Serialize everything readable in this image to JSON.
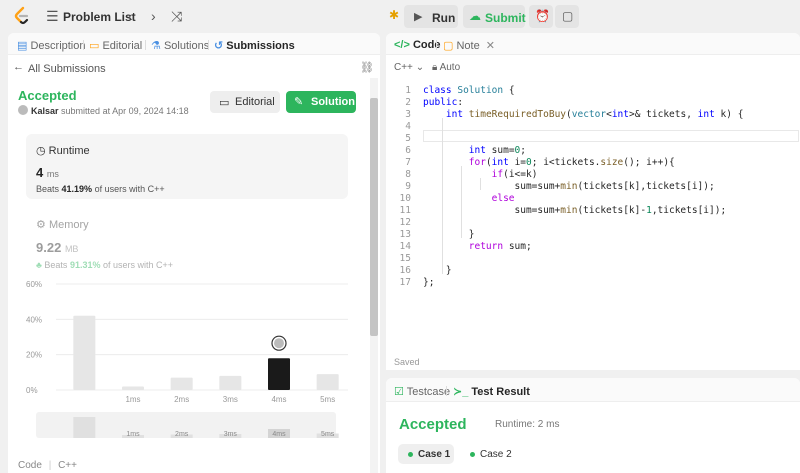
{
  "topbar": {
    "problem_list": "Problem List",
    "run_label": "Run",
    "submit_label": "Submit"
  },
  "left_tabs": [
    {
      "label": "Description"
    },
    {
      "label": "Editorial"
    },
    {
      "label": "Solutions"
    },
    {
      "label": "Submissions"
    }
  ],
  "back_link": "All Submissions",
  "submission": {
    "status": "Accepted",
    "user": "Kalsar",
    "meta": "submitted at Apr 09, 2024 14:18",
    "editorial_btn": "Editorial",
    "solution_btn": "Solution"
  },
  "runtime": {
    "title": "Runtime",
    "value": "4",
    "unit": "ms",
    "beats_prefix": "Beats",
    "beats_pct": "41.19%",
    "beats_suffix": "of users with C++"
  },
  "memory": {
    "title": "Memory",
    "value": "9.22",
    "unit": "MB",
    "beats_prefix": "Beats",
    "beats_pct": "91.31%",
    "beats_suffix": "of users with C++"
  },
  "chart_data": {
    "type": "bar",
    "categories": [
      "",
      "1ms",
      "2ms",
      "3ms",
      "4ms",
      "5ms"
    ],
    "values": [
      42,
      2,
      7,
      8,
      18,
      9
    ],
    "highlight_index": 4,
    "yticks": [
      "60%",
      "40%",
      "20%",
      "0%"
    ],
    "ylim": [
      0,
      60
    ],
    "grid": true,
    "overview_labels": [
      "1ms",
      "2ms",
      "3ms",
      "4ms",
      "5ms"
    ]
  },
  "left_footer": {
    "code": "Code",
    "lang": "C++"
  },
  "editor": {
    "tab_code": "Code",
    "tab_note": "Note",
    "language": "C++",
    "mode": "Auto",
    "saved": "Saved",
    "lines": [
      {
        "n": "1",
        "html": "<span class='kw'>class</span> <span class='cl'>Solution</span> {"
      },
      {
        "n": "2",
        "html": "<span class='kw'>public</span>:"
      },
      {
        "n": "3",
        "html": "    <span class='ty'>int</span> <span class='fn'>timeRequiredToBuy</span>(<span class='cl'>vector</span>&lt;<span class='ty'>int</span>&gt;&amp; tickets, <span class='ty'>int</span> k) {"
      },
      {
        "n": "4",
        "html": ""
      },
      {
        "n": "5",
        "html": ""
      },
      {
        "n": "6",
        "html": "        <span class='ty'>int</span> sum=<span class='nm'>0</span>;"
      },
      {
        "n": "7",
        "html": "        <span class='ct'>for</span>(<span class='ty'>int</span> i=<span class='nm'>0</span>; i&lt;tickets.<span class='fn'>size</span>(); i++){"
      },
      {
        "n": "8",
        "html": "            <span class='ct'>if</span>(i&lt;=k)"
      },
      {
        "n": "9",
        "html": "                sum=sum+<span class='fn'>min</span>(tickets[k],tickets[i]);"
      },
      {
        "n": "10",
        "html": "            <span class='ct'>else</span>"
      },
      {
        "n": "11",
        "html": "                sum=sum+<span class='fn'>min</span>(tickets[k]-<span class='nm'>1</span>,tickets[i]);"
      },
      {
        "n": "12",
        "html": ""
      },
      {
        "n": "13",
        "html": "        }"
      },
      {
        "n": "14",
        "html": "        <span class='ct'>return</span> sum;"
      },
      {
        "n": "15",
        "html": ""
      },
      {
        "n": "16",
        "html": "    }"
      },
      {
        "n": "17",
        "html": "};"
      }
    ]
  },
  "result": {
    "tab_testcase": "Testcase",
    "tab_result": "Test Result",
    "status": "Accepted",
    "runtime": "Runtime: 2 ms",
    "cases": [
      "Case 1",
      "Case 2"
    ]
  },
  "colors": {
    "accent_green": "#2db55d",
    "bar_dark": "#1a1a1a",
    "bar_light": "#e6e6e6"
  }
}
